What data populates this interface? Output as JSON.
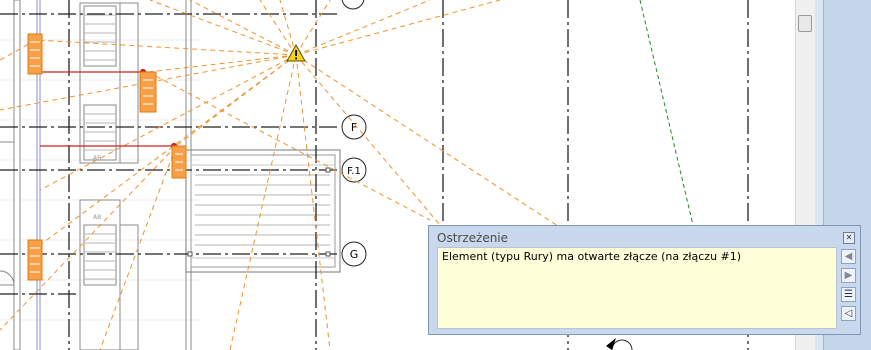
{
  "grid_labels": [
    "F",
    "F.1",
    "G"
  ],
  "element_tags": [
    "AB",
    "AB"
  ],
  "warning_dialog": {
    "title": "Ostrzeżenie",
    "message": "Element (typu Rury) ma otwarte złącze (na złączu #1)",
    "buttons": {
      "previous": "previous-arrow-icon",
      "next": "next-arrow-icon",
      "show": "details-icon",
      "sound": "speaker-icon"
    }
  },
  "colors": {
    "dialog_bg": "#c9d8ec",
    "message_bg": "#ffffd9",
    "orange_elements": "#f5941e",
    "red_pipe": "#cc2222",
    "blue_pipe": "#3d5bd9",
    "green_line": "#1f8a2d",
    "warning_yellow": "#f2d31a"
  }
}
